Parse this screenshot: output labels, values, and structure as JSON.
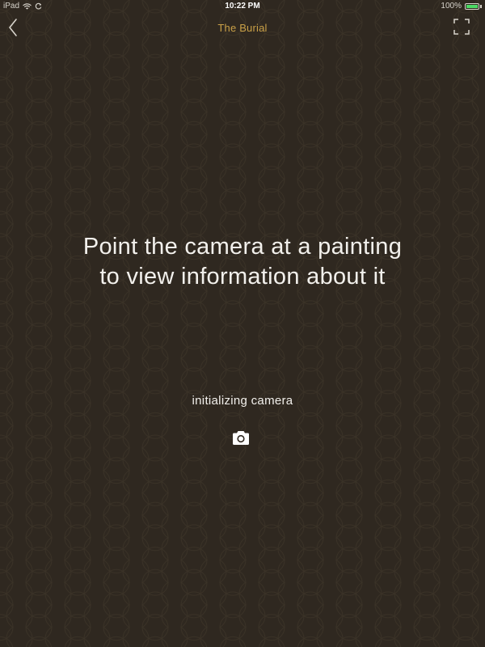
{
  "status_bar": {
    "device": "iPad",
    "time": "10:22 PM",
    "battery_percent": "100%",
    "battery_level": 1.0,
    "icons": [
      "wifi-icon",
      "sync-icon",
      "battery-icon"
    ],
    "battery_color": "#4cd964"
  },
  "nav": {
    "title": "The Burial",
    "back_icon": "chevron-left-icon",
    "fullscreen_icon": "expand-icon",
    "title_color": "#c9a047"
  },
  "main": {
    "instruction_line1": "Point the camera at a painting",
    "instruction_line2": "to view information about it",
    "status": "initializing camera",
    "camera_icon": "camera-icon"
  },
  "colors": {
    "background": "#2f2820",
    "pattern": "#3a3227",
    "text": "#f2f0ec"
  }
}
